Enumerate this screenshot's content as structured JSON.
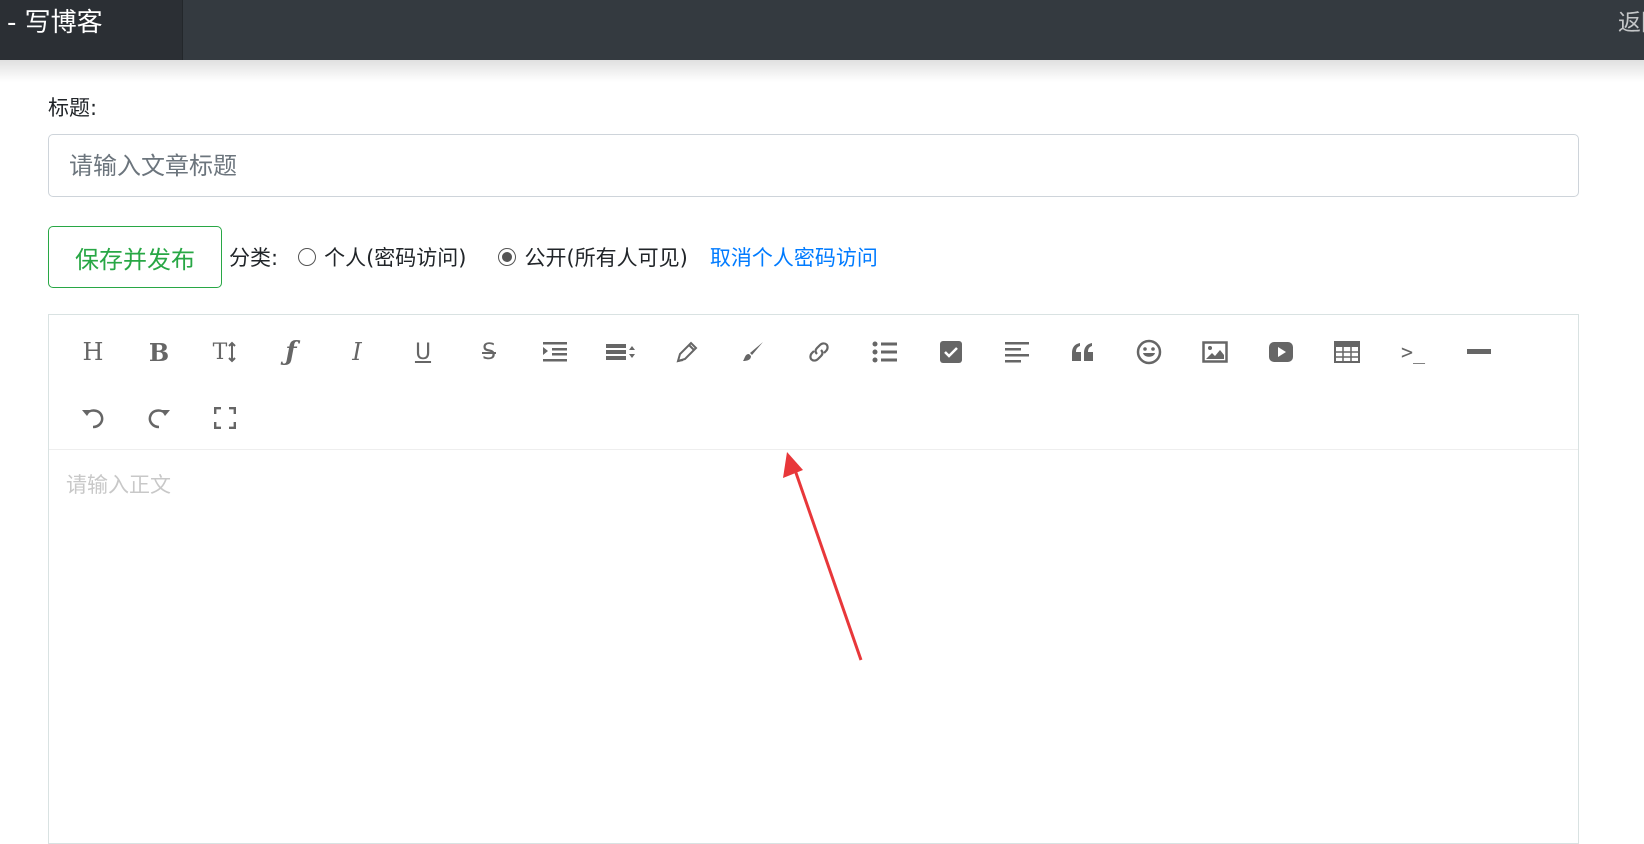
{
  "header": {
    "brand_title": "- 写博客",
    "back_label": "返回"
  },
  "form": {
    "title_label": "标题:",
    "title_placeholder": "请输入文章标题",
    "publish_button": "保存并发布",
    "category_label": "分类:",
    "category_options": [
      {
        "label": "个人(密码访问)",
        "checked": false
      },
      {
        "label": "公开(所有人可见)",
        "checked": true
      }
    ],
    "cancel_private_link": "取消个人密码访问"
  },
  "editor": {
    "placeholder": "请输入正文",
    "toolbar": [
      "heading-icon",
      "bold-icon",
      "font-size-icon",
      "font-family-icon",
      "italic-icon",
      "underline-icon",
      "strikethrough-icon",
      "indent-icon",
      "line-height-icon",
      "pen-icon",
      "brush-icon",
      "link-icon",
      "unordered-list-icon",
      "checkbox-icon",
      "align-left-icon",
      "quote-icon",
      "emoji-icon",
      "image-icon",
      "video-icon",
      "table-icon",
      "code-icon",
      "horizontal-rule-icon",
      "undo-icon",
      "redo-icon",
      "fullscreen-icon"
    ],
    "toolbar_heading_glyph": "H",
    "toolbar_bold_glyph": "B",
    "toolbar_fontsize_glyph": "T",
    "toolbar_fontfamily_glyph": "ƒ",
    "toolbar_italic_glyph": "I",
    "toolbar_underline_glyph": "U",
    "toolbar_strike_glyph": "S",
    "toolbar_code_glyph": ">_"
  },
  "annotation": {
    "arrow_color": "#e8373a"
  },
  "colors": {
    "topbar": "#343a40",
    "success": "#28a745",
    "link": "#007bff"
  }
}
